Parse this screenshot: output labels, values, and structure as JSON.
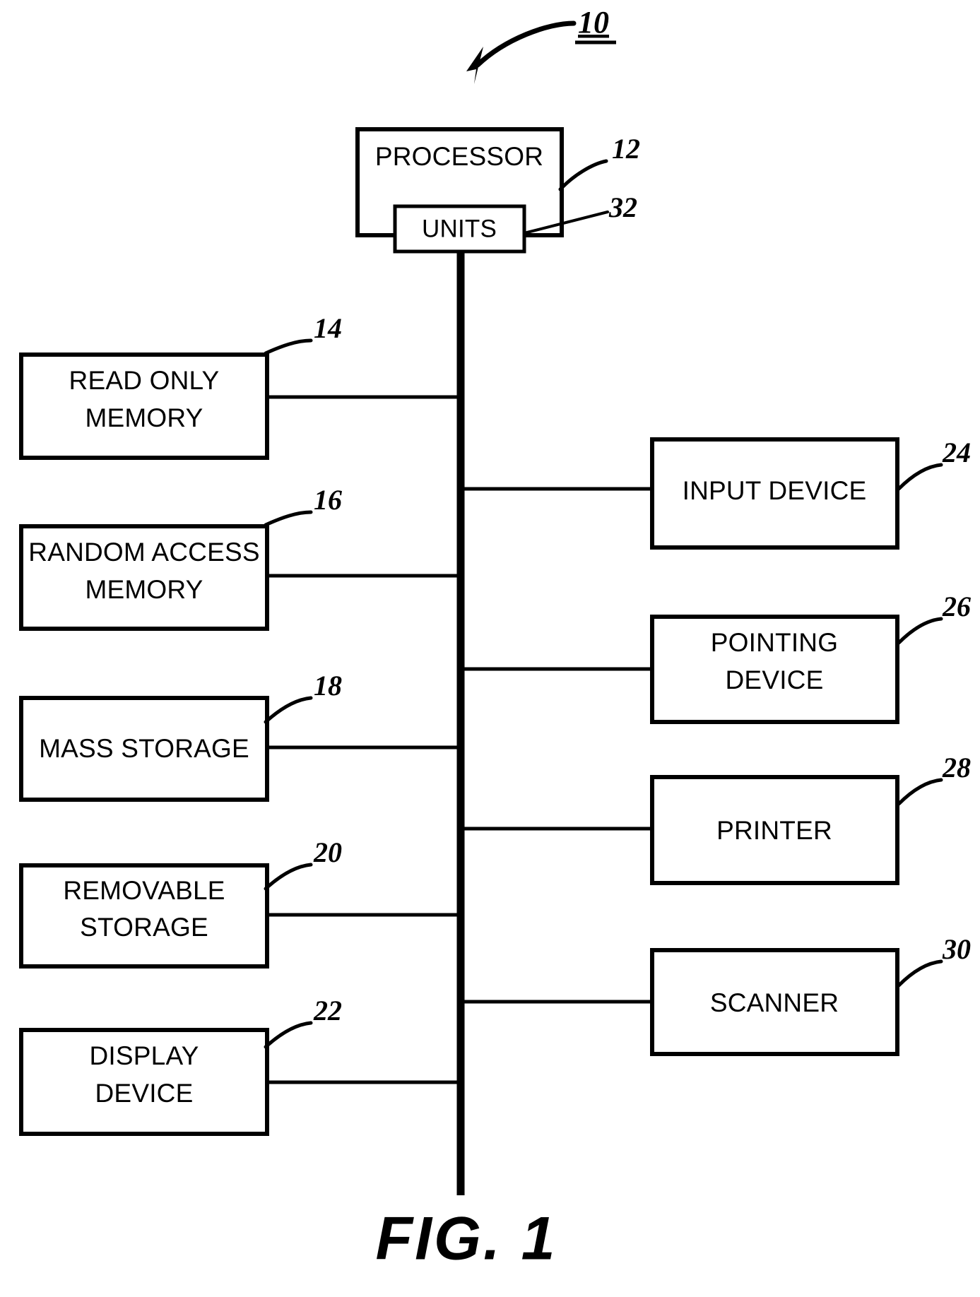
{
  "figure": {
    "caption": "FIG. 1",
    "system_ref": "10"
  },
  "processor": {
    "label": "PROCESSOR",
    "ref": "12",
    "inner": {
      "label": "UNITS",
      "ref": "32"
    }
  },
  "left_blocks": [
    {
      "label_line1": "READ ONLY",
      "label_line2": "MEMORY",
      "ref": "14"
    },
    {
      "label_line1": "RANDOM ACCESS",
      "label_line2": "MEMORY",
      "ref": "16"
    },
    {
      "label_line1": "MASS STORAGE",
      "label_line2": "",
      "ref": "18"
    },
    {
      "label_line1": "REMOVABLE",
      "label_line2": "STORAGE",
      "ref": "20"
    },
    {
      "label_line1": "DISPLAY",
      "label_line2": "DEVICE",
      "ref": "22"
    }
  ],
  "right_blocks": [
    {
      "label_line1": "INPUT DEVICE",
      "label_line2": "",
      "ref": "24"
    },
    {
      "label_line1": "POINTING",
      "label_line2": "DEVICE",
      "ref": "26"
    },
    {
      "label_line1": "PRINTER",
      "label_line2": "",
      "ref": "28"
    },
    {
      "label_line1": "SCANNER",
      "label_line2": "",
      "ref": "30"
    }
  ],
  "colors": {
    "ink": "#000000",
    "paper": "#ffffff"
  }
}
